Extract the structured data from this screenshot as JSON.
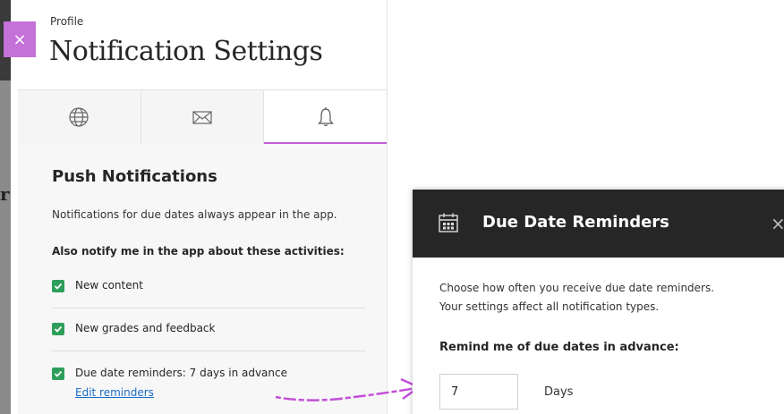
{
  "header": {
    "breadcrumb": "Profile",
    "title": "Notification Settings"
  },
  "tabs": [
    {
      "name": "globe-tab",
      "icon": "globe-icon"
    },
    {
      "name": "email-tab",
      "icon": "envelope-icon"
    },
    {
      "name": "push-tab",
      "icon": "bell-icon",
      "active": true
    }
  ],
  "close_icon": "×",
  "push": {
    "title": "Push Notifications",
    "info": "Notifications for due dates always appear in the app.",
    "also_notify": "Also notify me in the app about these activities:",
    "items": [
      {
        "label": "New content",
        "checked": true
      },
      {
        "label": "New grades and feedback",
        "checked": true
      },
      {
        "label": "Due date reminders: 7 days in advance",
        "checked": true
      }
    ],
    "edit_link": "Edit reminders"
  },
  "modal": {
    "title": "Due Date Reminders",
    "close": "×",
    "desc_line1": "Choose how often you receive due date reminders.",
    "desc_line2": "Your settings affect all notification types.",
    "remind_label": "Remind me of due dates in advance:",
    "days_value": "7",
    "days_unit": "Days"
  },
  "colors": {
    "accent": "#c05cd9",
    "check_green": "#2f9e5b",
    "modal_header": "#262626",
    "link": "#1a6cc9"
  }
}
